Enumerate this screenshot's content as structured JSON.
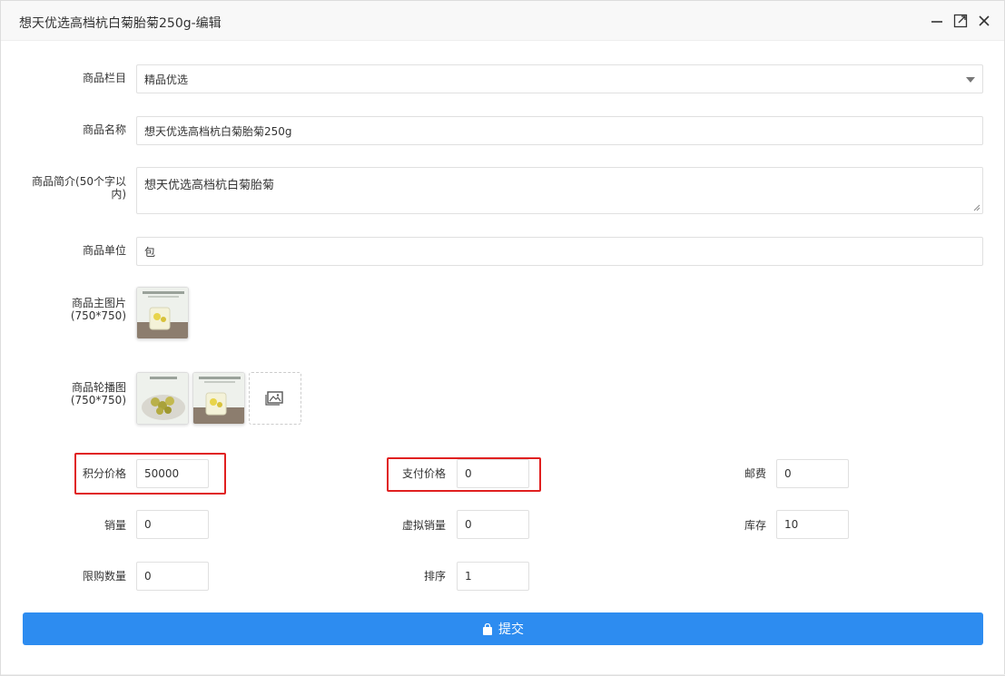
{
  "window": {
    "title": "想天优选高档杭白菊胎菊250g-编辑"
  },
  "icons": {
    "minimize": "minimize-icon",
    "maximize": "maximize-icon",
    "close": "close-icon",
    "image": "image-icon",
    "bag": "bag-icon"
  },
  "colors": {
    "accent": "#2d8cf0",
    "highlight": "#e02020"
  },
  "form": {
    "category": {
      "label": "商品栏目",
      "value": "精品优选"
    },
    "name": {
      "label": "商品名称",
      "value": "想天优选高档杭白菊胎菊250g"
    },
    "intro": {
      "label_1": "商品简介(50个字以",
      "label_2": "内)",
      "value": "想天优选高档杭白菊胎菊"
    },
    "unit": {
      "label": "商品单位",
      "value": "包"
    },
    "main_image": {
      "label": "商品主图片(750*750)"
    },
    "carousel": {
      "label": "商品轮播图(750*750)"
    },
    "points_price": {
      "label": "积分价格",
      "value": "50000"
    },
    "pay_price": {
      "label": "支付价格",
      "value": "0"
    },
    "postage": {
      "label": "邮费",
      "value": "0"
    },
    "sales": {
      "label": "销量",
      "value": "0"
    },
    "virtual_sales": {
      "label": "虚拟销量",
      "value": "0"
    },
    "stock": {
      "label": "库存",
      "value": "10"
    },
    "limit": {
      "label": "限购数量",
      "value": "0"
    },
    "sort": {
      "label": "排序",
      "value": "1"
    }
  },
  "submit": {
    "label": "提交"
  }
}
